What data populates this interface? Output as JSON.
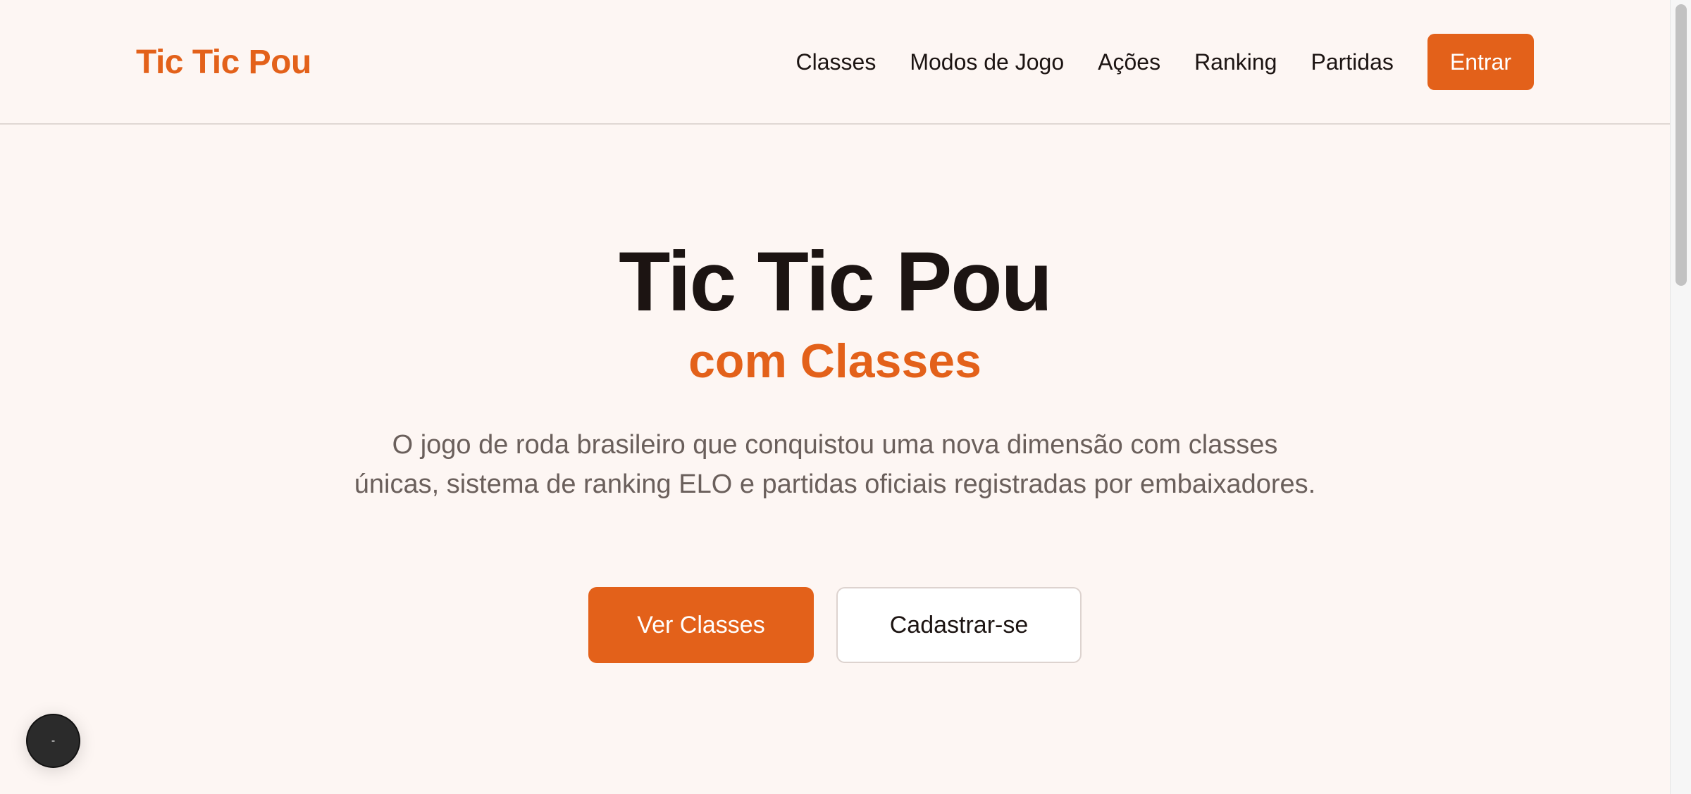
{
  "header": {
    "logo": "Tic Tic Pou",
    "nav": [
      {
        "label": "Classes"
      },
      {
        "label": "Modos de Jogo"
      },
      {
        "label": "Ações"
      },
      {
        "label": "Ranking"
      },
      {
        "label": "Partidas"
      }
    ],
    "login_label": "Entrar"
  },
  "hero": {
    "title": "Tic Tic Pou",
    "subtitle": "com Classes",
    "description": "O jogo de roda brasileiro que conquistou uma nova dimensão com classes únicas, sistema de ranking ELO e partidas oficiais registradas por embaixadores.",
    "primary_cta": "Ver Classes",
    "secondary_cta": "Cadastrar-se"
  },
  "floating_widget": {
    "label": "-"
  },
  "colors": {
    "accent": "#e3611a",
    "background": "#fdf6f3",
    "text": "#1c1412",
    "muted_text": "#6a5f5b"
  }
}
